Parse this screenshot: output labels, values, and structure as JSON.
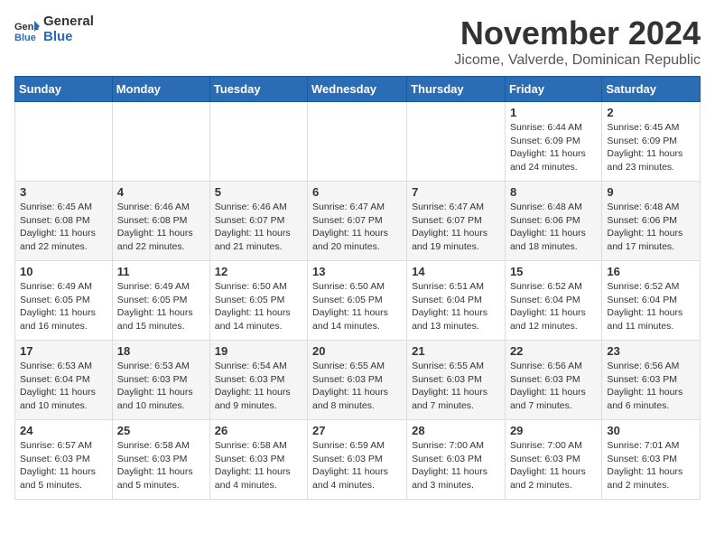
{
  "logo": {
    "text_general": "General",
    "text_blue": "Blue"
  },
  "header": {
    "month_year": "November 2024",
    "location": "Jicome, Valverde, Dominican Republic"
  },
  "weekdays": [
    "Sunday",
    "Monday",
    "Tuesday",
    "Wednesday",
    "Thursday",
    "Friday",
    "Saturday"
  ],
  "weeks": [
    [
      {
        "day": "",
        "sunrise": "",
        "sunset": "",
        "daylight": ""
      },
      {
        "day": "",
        "sunrise": "",
        "sunset": "",
        "daylight": ""
      },
      {
        "day": "",
        "sunrise": "",
        "sunset": "",
        "daylight": ""
      },
      {
        "day": "",
        "sunrise": "",
        "sunset": "",
        "daylight": ""
      },
      {
        "day": "",
        "sunrise": "",
        "sunset": "",
        "daylight": ""
      },
      {
        "day": "1",
        "sunrise": "Sunrise: 6:44 AM",
        "sunset": "Sunset: 6:09 PM",
        "daylight": "Daylight: 11 hours and 24 minutes."
      },
      {
        "day": "2",
        "sunrise": "Sunrise: 6:45 AM",
        "sunset": "Sunset: 6:09 PM",
        "daylight": "Daylight: 11 hours and 23 minutes."
      }
    ],
    [
      {
        "day": "3",
        "sunrise": "Sunrise: 6:45 AM",
        "sunset": "Sunset: 6:08 PM",
        "daylight": "Daylight: 11 hours and 22 minutes."
      },
      {
        "day": "4",
        "sunrise": "Sunrise: 6:46 AM",
        "sunset": "Sunset: 6:08 PM",
        "daylight": "Daylight: 11 hours and 22 minutes."
      },
      {
        "day": "5",
        "sunrise": "Sunrise: 6:46 AM",
        "sunset": "Sunset: 6:07 PM",
        "daylight": "Daylight: 11 hours and 21 minutes."
      },
      {
        "day": "6",
        "sunrise": "Sunrise: 6:47 AM",
        "sunset": "Sunset: 6:07 PM",
        "daylight": "Daylight: 11 hours and 20 minutes."
      },
      {
        "day": "7",
        "sunrise": "Sunrise: 6:47 AM",
        "sunset": "Sunset: 6:07 PM",
        "daylight": "Daylight: 11 hours and 19 minutes."
      },
      {
        "day": "8",
        "sunrise": "Sunrise: 6:48 AM",
        "sunset": "Sunset: 6:06 PM",
        "daylight": "Daylight: 11 hours and 18 minutes."
      },
      {
        "day": "9",
        "sunrise": "Sunrise: 6:48 AM",
        "sunset": "Sunset: 6:06 PM",
        "daylight": "Daylight: 11 hours and 17 minutes."
      }
    ],
    [
      {
        "day": "10",
        "sunrise": "Sunrise: 6:49 AM",
        "sunset": "Sunset: 6:05 PM",
        "daylight": "Daylight: 11 hours and 16 minutes."
      },
      {
        "day": "11",
        "sunrise": "Sunrise: 6:49 AM",
        "sunset": "Sunset: 6:05 PM",
        "daylight": "Daylight: 11 hours and 15 minutes."
      },
      {
        "day": "12",
        "sunrise": "Sunrise: 6:50 AM",
        "sunset": "Sunset: 6:05 PM",
        "daylight": "Daylight: 11 hours and 14 minutes."
      },
      {
        "day": "13",
        "sunrise": "Sunrise: 6:50 AM",
        "sunset": "Sunset: 6:05 PM",
        "daylight": "Daylight: 11 hours and 14 minutes."
      },
      {
        "day": "14",
        "sunrise": "Sunrise: 6:51 AM",
        "sunset": "Sunset: 6:04 PM",
        "daylight": "Daylight: 11 hours and 13 minutes."
      },
      {
        "day": "15",
        "sunrise": "Sunrise: 6:52 AM",
        "sunset": "Sunset: 6:04 PM",
        "daylight": "Daylight: 11 hours and 12 minutes."
      },
      {
        "day": "16",
        "sunrise": "Sunrise: 6:52 AM",
        "sunset": "Sunset: 6:04 PM",
        "daylight": "Daylight: 11 hours and 11 minutes."
      }
    ],
    [
      {
        "day": "17",
        "sunrise": "Sunrise: 6:53 AM",
        "sunset": "Sunset: 6:04 PM",
        "daylight": "Daylight: 11 hours and 10 minutes."
      },
      {
        "day": "18",
        "sunrise": "Sunrise: 6:53 AM",
        "sunset": "Sunset: 6:03 PM",
        "daylight": "Daylight: 11 hours and 10 minutes."
      },
      {
        "day": "19",
        "sunrise": "Sunrise: 6:54 AM",
        "sunset": "Sunset: 6:03 PM",
        "daylight": "Daylight: 11 hours and 9 minutes."
      },
      {
        "day": "20",
        "sunrise": "Sunrise: 6:55 AM",
        "sunset": "Sunset: 6:03 PM",
        "daylight": "Daylight: 11 hours and 8 minutes."
      },
      {
        "day": "21",
        "sunrise": "Sunrise: 6:55 AM",
        "sunset": "Sunset: 6:03 PM",
        "daylight": "Daylight: 11 hours and 7 minutes."
      },
      {
        "day": "22",
        "sunrise": "Sunrise: 6:56 AM",
        "sunset": "Sunset: 6:03 PM",
        "daylight": "Daylight: 11 hours and 7 minutes."
      },
      {
        "day": "23",
        "sunrise": "Sunrise: 6:56 AM",
        "sunset": "Sunset: 6:03 PM",
        "daylight": "Daylight: 11 hours and 6 minutes."
      }
    ],
    [
      {
        "day": "24",
        "sunrise": "Sunrise: 6:57 AM",
        "sunset": "Sunset: 6:03 PM",
        "daylight": "Daylight: 11 hours and 5 minutes."
      },
      {
        "day": "25",
        "sunrise": "Sunrise: 6:58 AM",
        "sunset": "Sunset: 6:03 PM",
        "daylight": "Daylight: 11 hours and 5 minutes."
      },
      {
        "day": "26",
        "sunrise": "Sunrise: 6:58 AM",
        "sunset": "Sunset: 6:03 PM",
        "daylight": "Daylight: 11 hours and 4 minutes."
      },
      {
        "day": "27",
        "sunrise": "Sunrise: 6:59 AM",
        "sunset": "Sunset: 6:03 PM",
        "daylight": "Daylight: 11 hours and 4 minutes."
      },
      {
        "day": "28",
        "sunrise": "Sunrise: 7:00 AM",
        "sunset": "Sunset: 6:03 PM",
        "daylight": "Daylight: 11 hours and 3 minutes."
      },
      {
        "day": "29",
        "sunrise": "Sunrise: 7:00 AM",
        "sunset": "Sunset: 6:03 PM",
        "daylight": "Daylight: 11 hours and 2 minutes."
      },
      {
        "day": "30",
        "sunrise": "Sunrise: 7:01 AM",
        "sunset": "Sunset: 6:03 PM",
        "daylight": "Daylight: 11 hours and 2 minutes."
      }
    ]
  ]
}
